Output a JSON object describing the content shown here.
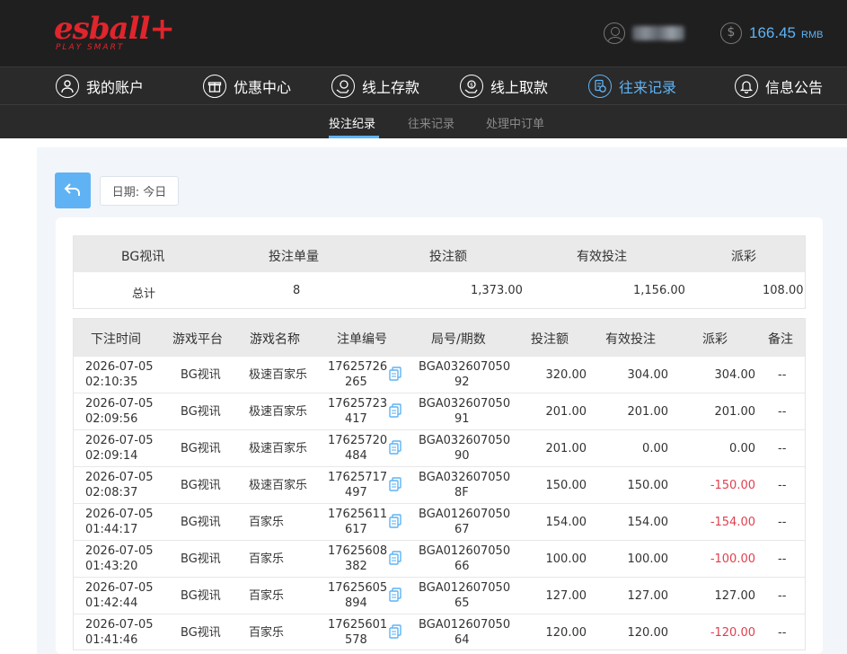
{
  "header": {
    "logo_text": "esball+",
    "logo_tagline": "PLAY SMART",
    "balance": "166.45",
    "currency": "RMB"
  },
  "colors": {
    "accent": "#5fb3f4",
    "brand": "#e0252c",
    "negative": "#e0404f",
    "header_bg": "#1f1f1f"
  },
  "nav": [
    {
      "label": "我的账户",
      "icon": "user-circle-icon"
    },
    {
      "label": "优惠中心",
      "icon": "gift-icon"
    },
    {
      "label": "线上存款",
      "icon": "deposit-icon"
    },
    {
      "label": "线上取款",
      "icon": "withdraw-icon"
    },
    {
      "label": "往来记录",
      "icon": "records-icon",
      "active": true
    },
    {
      "label": "信息公告",
      "icon": "bell-icon"
    }
  ],
  "subnav": [
    {
      "label": "投注纪录",
      "active": true
    },
    {
      "label": "往来记录"
    },
    {
      "label": "处理中订单"
    }
  ],
  "filter": {
    "date_label": "日期: 今日"
  },
  "summary": {
    "headers": [
      "BG视讯",
      "投注单量",
      "投注额",
      "有效投注",
      "派彩"
    ],
    "row": [
      "总计",
      "8",
      "1,373.00",
      "1,156.00",
      "108.00"
    ]
  },
  "detail": {
    "headers": [
      "下注时间",
      "游戏平台",
      "游戏名称",
      "注单编号",
      "局号/期数",
      "投注额",
      "有效投注",
      "派彩",
      "备注"
    ],
    "rows": [
      {
        "date": "2026-07-05",
        "time": "02:10:35",
        "platform": "BG视讯",
        "game": "极速百家乐",
        "id1": "17625726",
        "id2": "265",
        "round1": "BGA032607050",
        "round2": "92",
        "bet": "320.00",
        "valid": "304.00",
        "payout": "304.00",
        "negative": false,
        "note": "--"
      },
      {
        "date": "2026-07-05",
        "time": "02:09:56",
        "platform": "BG视讯",
        "game": "极速百家乐",
        "id1": "17625723",
        "id2": "417",
        "round1": "BGA032607050",
        "round2": "91",
        "bet": "201.00",
        "valid": "201.00",
        "payout": "201.00",
        "negative": false,
        "note": "--"
      },
      {
        "date": "2026-07-05",
        "time": "02:09:14",
        "platform": "BG视讯",
        "game": "极速百家乐",
        "id1": "17625720",
        "id2": "484",
        "round1": "BGA032607050",
        "round2": "90",
        "bet": "201.00",
        "valid": "0.00",
        "payout": "0.00",
        "negative": false,
        "note": "--"
      },
      {
        "date": "2026-07-05",
        "time": "02:08:37",
        "platform": "BG视讯",
        "game": "极速百家乐",
        "id1": "17625717",
        "id2": "497",
        "round1": "BGA032607050",
        "round2": "8F",
        "bet": "150.00",
        "valid": "150.00",
        "payout": "-150.00",
        "negative": true,
        "note": "--"
      },
      {
        "date": "2026-07-05",
        "time": "01:44:17",
        "platform": "BG视讯",
        "game": "百家乐",
        "id1": "17625611",
        "id2": "617",
        "round1": "BGA012607050",
        "round2": "67",
        "bet": "154.00",
        "valid": "154.00",
        "payout": "-154.00",
        "negative": true,
        "note": "--"
      },
      {
        "date": "2026-07-05",
        "time": "01:43:20",
        "platform": "BG视讯",
        "game": "百家乐",
        "id1": "17625608",
        "id2": "382",
        "round1": "BGA012607050",
        "round2": "66",
        "bet": "100.00",
        "valid": "100.00",
        "payout": "-100.00",
        "negative": true,
        "note": "--"
      },
      {
        "date": "2026-07-05",
        "time": "01:42:44",
        "platform": "BG视讯",
        "game": "百家乐",
        "id1": "17625605",
        "id2": "894",
        "round1": "BGA012607050",
        "round2": "65",
        "bet": "127.00",
        "valid": "127.00",
        "payout": "127.00",
        "negative": false,
        "note": "--"
      },
      {
        "date": "2026-07-05",
        "time": "01:41:46",
        "platform": "BG视讯",
        "game": "百家乐",
        "id1": "17625601",
        "id2": "578",
        "round1": "BGA012607050",
        "round2": "64",
        "bet": "120.00",
        "valid": "120.00",
        "payout": "-120.00",
        "negative": true,
        "note": "--"
      }
    ]
  }
}
